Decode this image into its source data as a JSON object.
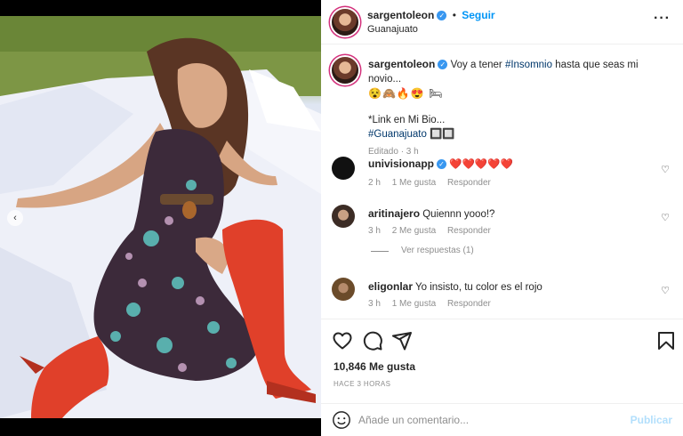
{
  "post": {
    "image_alt": "",
    "carousel_prev": "‹"
  },
  "header": {
    "username": "sargentoleon",
    "follow_label": "Seguir",
    "location": "Guanajuato",
    "more_icon": "more-horizontal-icon"
  },
  "caption": {
    "username": "sargentoleon",
    "text_prefix": "Voy a tener ",
    "hashtag1": "#Insomnio",
    "text_suffix": " hasta que seas mi novio...",
    "emojis": "😵🙈🔥😍 🛏",
    "line2": "*Link en Mi Bio...",
    "hashtag2": "#Guanajuato",
    "trailing": " 🔲🔲",
    "edited": "Editado · 3 h"
  },
  "comments": [
    {
      "username": "univisionapp",
      "text": "❤️❤️❤️❤️❤️",
      "age": "2 h",
      "likes": "1 Me gusta",
      "reply": "Responder"
    },
    {
      "username": "aritinajero",
      "text": "Quiennn yooo!?",
      "age": "3 h",
      "likes": "2 Me gusta",
      "reply": "Responder",
      "view_replies": "Ver respuestas (1)"
    },
    {
      "username": "eligonlar",
      "text": "Yo insisto, tu color es el rojo",
      "age": "3 h",
      "likes": "1 Me gusta",
      "reply": "Responder"
    }
  ],
  "actions": {
    "likes": "10,846 Me gusta",
    "time": "HACE 3 HORAS"
  },
  "composer": {
    "placeholder": "Añade un comentario...",
    "publish": "Publicar"
  },
  "colors": {
    "accent": "#0095f6",
    "verified": "#3897f0",
    "hashtag": "#00376b",
    "boots": "#e0402a"
  }
}
